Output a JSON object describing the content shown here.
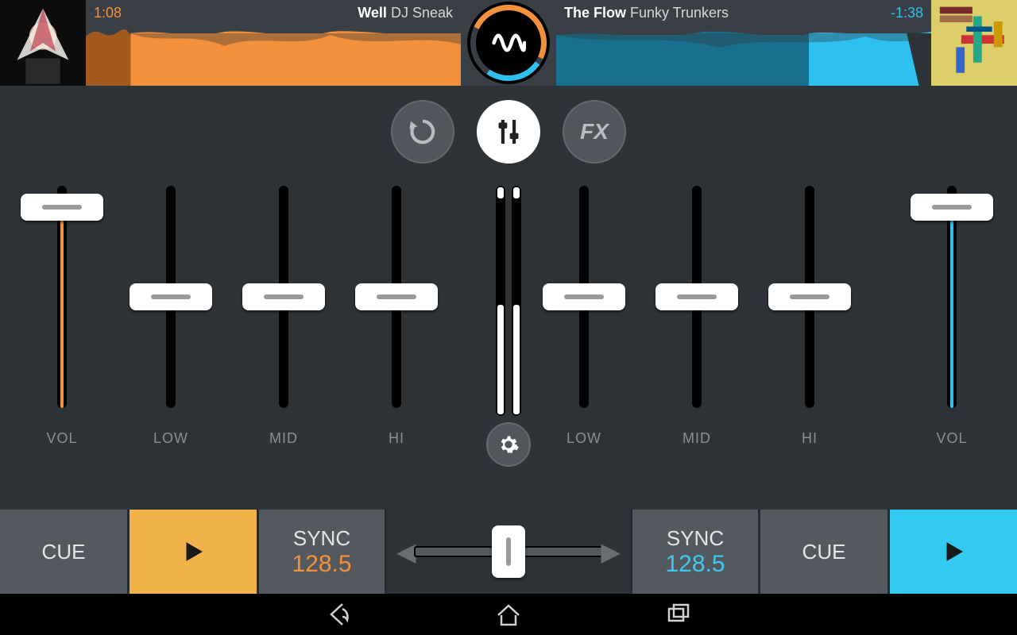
{
  "deckA": {
    "time": "1:08",
    "title": "Well",
    "artist": "DJ Sneak",
    "vol_label": "VOL",
    "eq": {
      "low": "LOW",
      "mid": "MID",
      "hi": "HI"
    },
    "cue_label": "CUE",
    "sync_label": "SYNC",
    "bpm": "128.5",
    "accent_color": "#f2903b"
  },
  "deckB": {
    "time": "-1:38",
    "title": "The Flow",
    "artist": "Funky Trunkers",
    "vol_label": "VOL",
    "eq": {
      "low": "LOW",
      "mid": "MID",
      "hi": "HI"
    },
    "cue_label": "CUE",
    "sync_label": "SYNC",
    "bpm": "128.5",
    "accent_color": "#2ec0ee"
  },
  "modes": {
    "loop": "loop",
    "mixer": "mixer",
    "fx": "FX"
  },
  "sliders": {
    "volA": {
      "pos_pct": 7
    },
    "volB": {
      "pos_pct": 7
    },
    "lowA": {
      "pos_pct": 50
    },
    "midA": {
      "pos_pct": 50
    },
    "hiA": {
      "pos_pct": 50
    },
    "lowB": {
      "pos_pct": 50
    },
    "midB": {
      "pos_pct": 50
    },
    "hiB": {
      "pos_pct": 50
    },
    "crossfader_pct": 50,
    "xfade_bottom_pct": 50
  }
}
